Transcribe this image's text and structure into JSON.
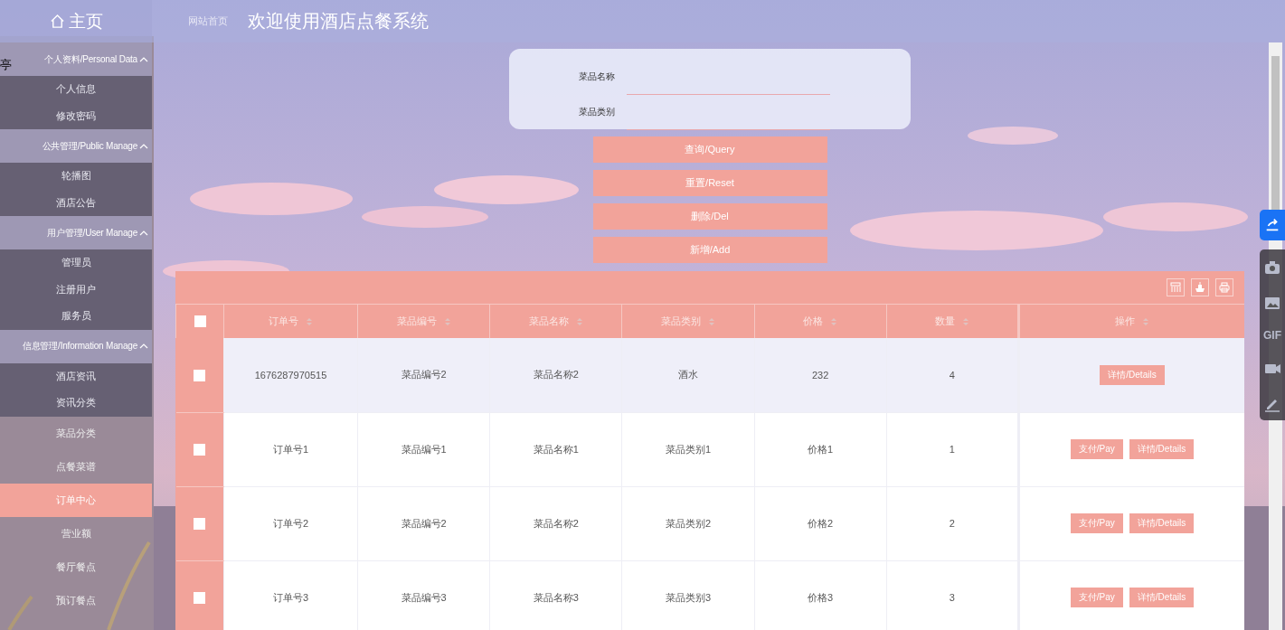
{
  "sidebar": {
    "home": "主页",
    "edge_text": "亭",
    "nav": [
      {
        "kind": "group",
        "label": "个人资料/Personal Data",
        "expanded": true,
        "children": [
          {
            "label": "个人信息",
            "selected": false
          },
          {
            "label": "修改密码",
            "selected": false
          }
        ]
      },
      {
        "kind": "group",
        "label": "公共管理/Public Manage",
        "expanded": true,
        "children": [
          {
            "label": "轮播图",
            "selected": false
          },
          {
            "label": "酒店公告",
            "selected": false
          }
        ]
      },
      {
        "kind": "group",
        "label": "用户管理/User Manage",
        "expanded": true,
        "children": [
          {
            "label": "管理员",
            "selected": false
          },
          {
            "label": "注册用户",
            "selected": false
          },
          {
            "label": "服务员",
            "selected": false
          }
        ]
      },
      {
        "kind": "group",
        "label": "信息管理/Information Manage",
        "expanded": true,
        "children": [
          {
            "label": "酒店资讯",
            "selected": false
          },
          {
            "label": "资讯分类",
            "selected": false
          }
        ]
      },
      {
        "kind": "item",
        "label": "菜品分类",
        "selected": false
      },
      {
        "kind": "item",
        "label": "点餐菜谱",
        "selected": false
      },
      {
        "kind": "item",
        "label": "订单中心",
        "selected": true
      },
      {
        "kind": "item",
        "label": "营业额",
        "selected": false
      },
      {
        "kind": "item",
        "label": "餐厅餐点",
        "selected": false
      },
      {
        "kind": "item",
        "label": "预订餐点",
        "selected": false
      }
    ]
  },
  "header": {
    "breadcrumb": "网站首页",
    "title": "欢迎使用酒店点餐系统"
  },
  "search_form": {
    "fields": [
      {
        "label": "菜品名称"
      },
      {
        "label": "菜品类别"
      }
    ],
    "buttons": [
      "查询/Query",
      "重置/Reset",
      "删除/Del",
      "新增/Add"
    ]
  },
  "table": {
    "all_checked": false,
    "columns": [
      "订单号",
      "菜品编号",
      "菜品名称",
      "菜品类别",
      "价格",
      "数量",
      "操作"
    ],
    "rows": [
      {
        "checked": false,
        "hovered": true,
        "cells": [
          "1676287970515",
          "菜品编号2",
          "菜品名称2",
          "酒水",
          "232",
          "4"
        ],
        "actions": [
          "详情/Details"
        ]
      },
      {
        "checked": false,
        "hovered": false,
        "cells": [
          "订单号1",
          "菜品编号1",
          "菜品名称1",
          "菜品类别1",
          "价格1",
          "1"
        ],
        "actions": [
          "支付/Pay",
          "详情/Details"
        ]
      },
      {
        "checked": false,
        "hovered": false,
        "cells": [
          "订单号2",
          "菜品编号2",
          "菜品名称2",
          "菜品类别2",
          "价格2",
          "2"
        ],
        "actions": [
          "支付/Pay",
          "详情/Details"
        ]
      },
      {
        "checked": false,
        "hovered": false,
        "cells": [
          "订单号3",
          "菜品编号3",
          "菜品名称3",
          "菜品类别3",
          "价格3",
          "3"
        ],
        "actions": [
          "支付/Pay",
          "详情/Details"
        ]
      }
    ]
  },
  "capture_toolbar": {
    "gif_label": "GIF"
  }
}
